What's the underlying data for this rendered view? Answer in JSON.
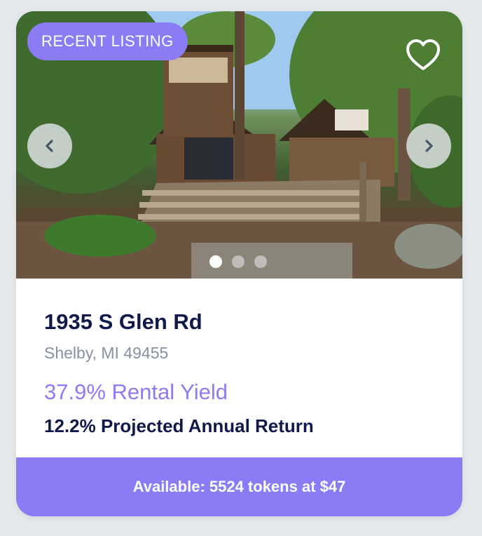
{
  "listing": {
    "badge": "RECENT LISTING",
    "address": "1935 S Glen Rd",
    "city": "Shelby, MI 49455",
    "rental_yield": "37.9% Rental Yield",
    "projected_return": "12.2% Projected Annual Return",
    "availability": "Available: 5524 tokens at $47"
  },
  "carousel": {
    "slide_count": 3,
    "active_index": 0
  },
  "colors": {
    "accent": "#8b7cf5",
    "title": "#101a4a",
    "subtitle": "#8a90a3"
  },
  "icons": {
    "favorite": "heart-outline-icon",
    "previous": "chevron-left-icon",
    "next": "chevron-right-icon"
  }
}
